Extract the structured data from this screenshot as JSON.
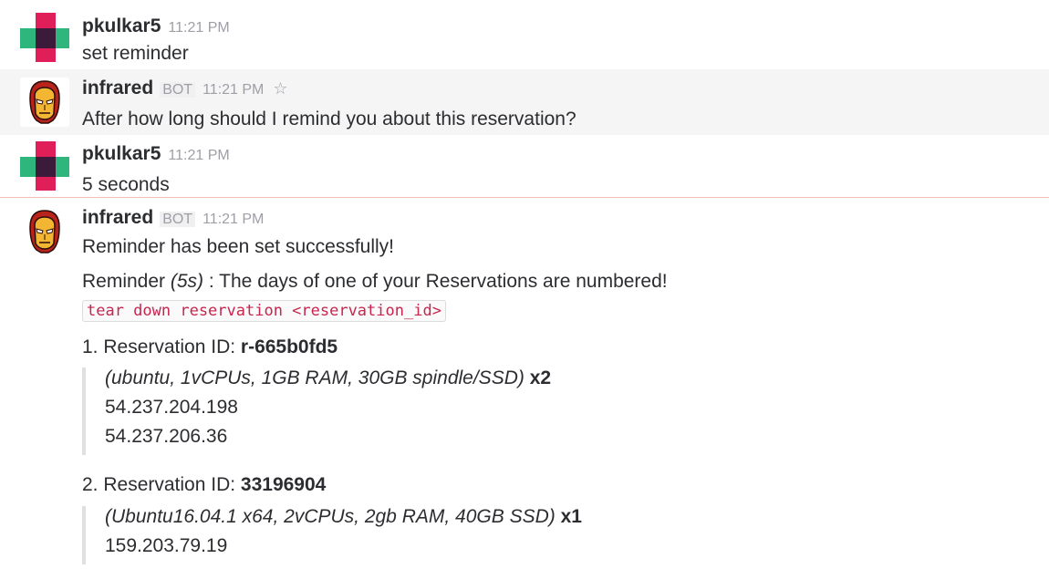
{
  "messages": [
    {
      "user": "pkulkar5",
      "time": "11:21 PM",
      "text": "set reminder"
    },
    {
      "user": "infrared",
      "badge": "BOT",
      "time": "11:21 PM",
      "text": "After how long should I remind you about this reservation?"
    },
    {
      "user": "pkulkar5",
      "time": "11:21 PM",
      "text": "5 seconds"
    },
    {
      "user": "infrared",
      "badge": "BOT",
      "time": "11:21 PM",
      "text": "Reminder has been set successfully!",
      "reminder": {
        "prefix": "Reminder ",
        "interval": "(5s)",
        "suffix": " : The days of one of your Reservations are numbered!",
        "command": "tear down reservation <reservation_id>"
      },
      "reservations": [
        {
          "label": "1. Reservation ID: ",
          "id": "r-665b0fd5",
          "spec": "(ubuntu, 1vCPUs, 1GB RAM, 30GB spindle/SSD)",
          "count": " x2",
          "ips": [
            "54.237.204.198",
            "54.237.206.36"
          ]
        },
        {
          "label": "2. Reservation ID: ",
          "id": "33196904",
          "spec": "(Ubuntu16.04.1 x64, 2vCPUs, 2gb RAM, 40GB SSD)",
          "count": " x1",
          "ips": [
            "159.203.79.19"
          ]
        }
      ]
    }
  ],
  "colors": {
    "username": "#2c2d30",
    "timestamp": "#9e9ea6",
    "code": "#c7254e",
    "divider": "#f2c0b0",
    "avatar_pink": "#e01e5a",
    "avatar_green": "#2eb67d",
    "avatar_dark": "#4a154b"
  },
  "icons": {
    "user_avatar": "pink-green-cross-avatar",
    "bot_avatar": "iron-man-helmet-avatar",
    "star": "star-outline-icon"
  }
}
